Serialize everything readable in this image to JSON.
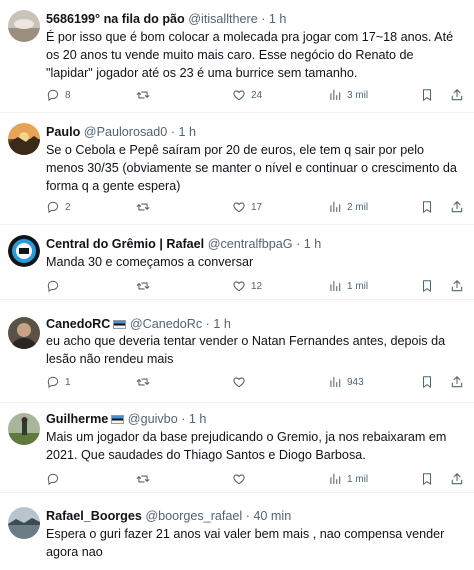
{
  "tweets": [
    {
      "name": "5686199° na fila do pão",
      "handle": "@itisallthere",
      "sep": "·",
      "time": "1 h",
      "text": "É por isso que é bom colocar a molecada pra jogar com 17~18 anos. Até os 20 anos tu vende muito mais caro. Esse negócio do Renato de \"lapidar\" jogador até os 23 é uma burrice sem tamanho.",
      "replies": "8",
      "retweets": "",
      "likes": "24",
      "views": "3 mil",
      "avatar_icon": "sky-photo-avatar"
    },
    {
      "name": "Paulo",
      "handle": "@Paulorosad0",
      "sep": "·",
      "time": "1 h",
      "text": "Se o Cebola e Pepê saíram por 20 de euros, ele tem q sair por pelo menos 30/35 (obviamente se manter o nível e continuar o crescimento da forma q a gente espera)",
      "replies": "2",
      "retweets": "",
      "likes": "17",
      "views": "2 mil",
      "avatar_icon": "sunset-photo-avatar"
    },
    {
      "name": "Central do Grêmio | Rafael",
      "handle": "@centralfbpaG",
      "sep": "·",
      "time": "1 h",
      "text": "Manda 30 e começamos a conversar",
      "replies": "",
      "retweets": "",
      "likes": "12",
      "views": "1 mil",
      "avatar_icon": "club-badge-avatar"
    },
    {
      "name": "CanedoRC",
      "handle": "@CanedoRc",
      "sep": "·",
      "time": "1 h",
      "text": "eu acho que deveria tentar vender o Natan Fernandes antes, depois da lesão não rendeu mais",
      "replies": "1",
      "retweets": "",
      "likes": "",
      "views": "943",
      "avatar_icon": "person-photo-avatar"
    },
    {
      "name": "Guilherme",
      "handle": "@guivbo",
      "sep": "·",
      "time": "1 h",
      "text": "Mais um jogador da base prejudicando o Gremio, ja nos rebaixaram em 2021. Que saudades do Thiago Santos e Diogo Barbosa.",
      "replies": "",
      "retweets": "",
      "likes": "",
      "views": "1 mil",
      "avatar_icon": "field-photo-avatar"
    },
    {
      "name": "Rafael_Boorges",
      "handle": "@boorges_rafael",
      "sep": "·",
      "time": "40 min",
      "text": "Espera o guri fazer 21 anos vai valer bem mais  , nao compensa vender agora nao",
      "replies": "",
      "retweets": "",
      "likes": "",
      "views": "",
      "avatar_icon": "lake-photo-avatar"
    }
  ],
  "colors": {
    "text": "#0f1419",
    "muted": "#536471",
    "divider": "#eff3f4"
  }
}
